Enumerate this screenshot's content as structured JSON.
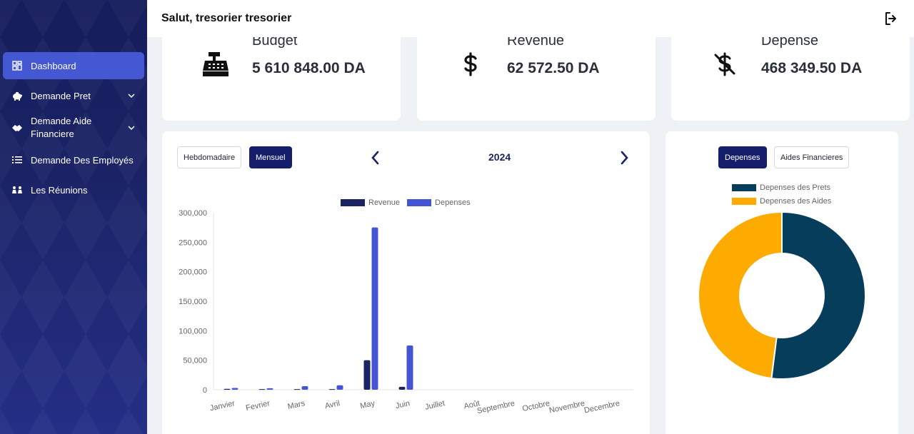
{
  "header": {
    "greeting": "Salut, tresorier tresorier"
  },
  "sidebar": {
    "items": [
      {
        "label": "Dashboard",
        "active": true,
        "icon": "dashboard-icon"
      },
      {
        "label": "Demande Pret",
        "icon": "piggy-bank-icon",
        "chevron": true
      },
      {
        "label": "Demande Aide Financiere",
        "icon": "handshake-icon",
        "chevron": true
      },
      {
        "label": "Demande Des Employés",
        "icon": "list-icon"
      },
      {
        "label": "Les Réunions",
        "icon": "people-icon"
      }
    ]
  },
  "stats": [
    {
      "title": "Budget",
      "value": "5 610 848.00 DA",
      "icon": "cash-register-icon"
    },
    {
      "title": "Revenue",
      "value": "62 572.50 DA",
      "icon": "dollar-icon"
    },
    {
      "title": "Depense",
      "value": "468 349.50 DA",
      "icon": "dollar-slash-icon"
    }
  ],
  "bar_panel": {
    "tabs": [
      "Hebdomadaire",
      "Mensuel"
    ],
    "active_tab": "Mensuel",
    "year": "2024"
  },
  "pie_panel": {
    "tabs": [
      "Depenses",
      "Aides Financieres"
    ],
    "active_tab": "Depenses"
  },
  "colors": {
    "revenue": "#1b2463",
    "depenses": "#4455d4",
    "prets": "#053d5a",
    "aides": "#fdab00",
    "accent": "#141e6b"
  },
  "chart_data": [
    {
      "type": "bar",
      "categories": [
        "Janvier",
        "Fevrier",
        "Mars",
        "Avril",
        "May",
        "Juin",
        "Juillet",
        "Août",
        "Septembre",
        "Octobre",
        "Novembre",
        "Decembre"
      ],
      "series": [
        {
          "name": "Revenue",
          "values": [
            1500,
            1000,
            1000,
            1000,
            50000,
            5000,
            0,
            0,
            0,
            0,
            0,
            0
          ]
        },
        {
          "name": "Depenses",
          "values": [
            3000,
            2500,
            6000,
            7500,
            275000,
            75000,
            0,
            0,
            0,
            0,
            0,
            0
          ]
        }
      ],
      "yticks": [
        "300,000",
        "250,000",
        "200,000",
        "150,000",
        "100,000",
        "50,000",
        "0"
      ],
      "ylim": [
        0,
        300000
      ],
      "legend": "top"
    },
    {
      "type": "pie",
      "donut": true,
      "labels": [
        "Depenses des Prets",
        "Depenses des Aides"
      ],
      "values": [
        52,
        48
      ],
      "legend": "top"
    }
  ]
}
